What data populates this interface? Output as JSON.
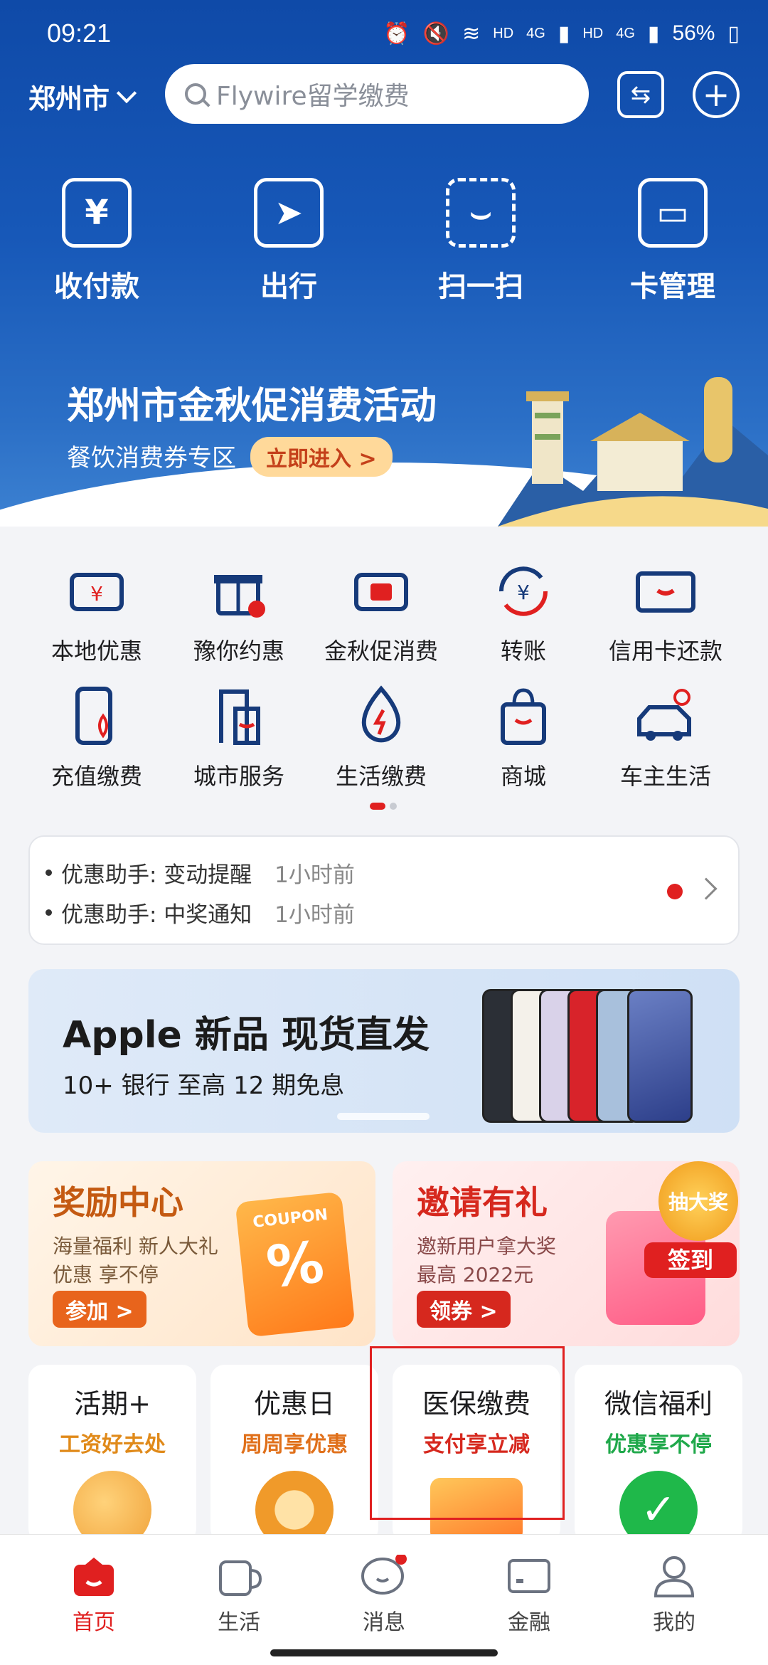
{
  "status_bar": {
    "time": "09:21",
    "net1": "HD",
    "net2": "4G",
    "net3": "HD",
    "net4": "4G",
    "battery": "56%"
  },
  "header": {
    "city": "郑州市",
    "search_placeholder": "Flywire留学缴费"
  },
  "quick_actions": [
    {
      "label": "收付款",
      "icon": "yen-receipt-icon"
    },
    {
      "label": "出行",
      "icon": "navigation-icon"
    },
    {
      "label": "扫一扫",
      "icon": "scan-icon"
    },
    {
      "label": "卡管理",
      "icon": "card-icon"
    }
  ],
  "banner": {
    "title": "郑州市金秋促消费活动",
    "subtitle": "餐饮消费券专区",
    "cta": "立即进入 >"
  },
  "services": [
    {
      "label": "本地优惠",
      "icon": "coupon-yen-icon"
    },
    {
      "label": "豫你约惠",
      "icon": "gift-box-icon"
    },
    {
      "label": "金秋促消费",
      "icon": "voucher-icon"
    },
    {
      "label": "转账",
      "icon": "transfer-icon"
    },
    {
      "label": "信用卡还款",
      "icon": "credit-card-icon"
    },
    {
      "label": "充值缴费",
      "icon": "phone-topup-icon"
    },
    {
      "label": "城市服务",
      "icon": "city-door-icon"
    },
    {
      "label": "生活缴费",
      "icon": "utility-flame-icon"
    },
    {
      "label": "商城",
      "icon": "shopping-bag-icon"
    },
    {
      "label": "车主生活",
      "icon": "car-icon"
    }
  ],
  "notices": [
    {
      "text": "优惠助手: 变动提醒",
      "time": "1小时前"
    },
    {
      "text": "优惠助手: 中奖通知",
      "time": "1小时前"
    }
  ],
  "apple_banner": {
    "title": "Apple 新品 现货直发",
    "subtitle": "10+ 银行 至高 12 期免息"
  },
  "promos": [
    {
      "title": "奖励中心",
      "line1": "海量福利 新人大礼",
      "line2": "优惠 享不停",
      "button": "参加 >",
      "badge": "COUPON"
    },
    {
      "title": "邀请有礼",
      "line1": "邀新用户拿大奖",
      "line2": "最高 2022元",
      "button": "领券 >",
      "badge1": "抽大奖",
      "badge2": "签到"
    }
  ],
  "feature_cards": [
    {
      "title": "活期+",
      "subtitle": "工资好去处",
      "subtitle_color": "#e08a1a"
    },
    {
      "title": "优惠日",
      "subtitle": "周周享优惠",
      "subtitle_color": "#e0701a"
    },
    {
      "title": "医保缴费",
      "subtitle": "支付享立减",
      "subtitle_color": "#d6281e"
    },
    {
      "title": "微信福利",
      "subtitle": "优惠享不停",
      "subtitle_color": "#1fa84a"
    }
  ],
  "tabbar": [
    {
      "label": "首页",
      "icon": "home-icon",
      "active": true
    },
    {
      "label": "生活",
      "icon": "cup-icon",
      "active": false
    },
    {
      "label": "消息",
      "icon": "message-icon",
      "active": false
    },
    {
      "label": "金融",
      "icon": "finance-card-icon",
      "active": false
    },
    {
      "label": "我的",
      "icon": "profile-icon",
      "active": false
    }
  ],
  "colors": {
    "primary_blue": "#1758b8",
    "accent_red": "#e02020"
  }
}
